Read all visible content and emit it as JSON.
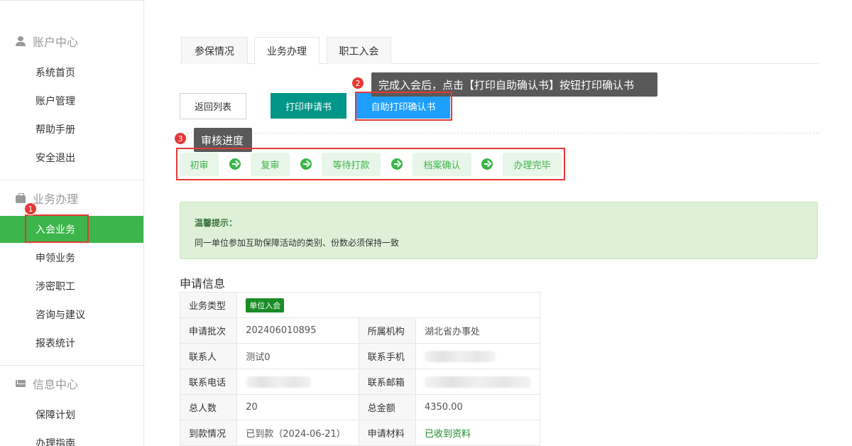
{
  "sidebar": {
    "account_center": {
      "title": "账户中心",
      "items": [
        "系统首页",
        "账户管理",
        "帮助手册",
        "安全退出"
      ]
    },
    "business": {
      "title": "业务办理",
      "items": [
        "入会业务",
        "申领业务",
        "涉密职工",
        "咨询与建议",
        "报表统计"
      ]
    },
    "info_center": {
      "title": "信息中心",
      "items": [
        "保障计划",
        "办理指南"
      ]
    }
  },
  "tabs": [
    "参保情况",
    "业务办理",
    "职工入会"
  ],
  "active_tab": "业务办理",
  "active_nav": "入会业务",
  "buttons": {
    "back": "返回列表",
    "print_application": "打印申请书",
    "self_print": "自助打印确认书"
  },
  "markers": [
    "1",
    "2",
    "3"
  ],
  "tooltips": {
    "print_hint": "完成入会后，点击【打印自助确认书】按钮打印确认书",
    "progress": "审核进度"
  },
  "progress_steps": [
    "初审",
    "复审",
    "等待打款",
    "档案确认",
    "办理完毕"
  ],
  "tip": {
    "title": "温馨提示：",
    "text": "同一单位参加互助保障活动的类别、份数必须保持一致"
  },
  "application_info": {
    "title": "申请信息",
    "business_type_label": "业务类型",
    "business_type": "单位入会",
    "rows": [
      [
        "申请批次",
        "202406010895",
        "所属机构",
        "湖北省办事处"
      ],
      [
        "联系人",
        "测试0",
        "联系手机",
        ""
      ],
      [
        "联系电话",
        "",
        "联系邮箱",
        ""
      ],
      [
        "总人数",
        "20",
        "总金额",
        "4350.00"
      ],
      [
        "到款情况",
        "已到款（2024-06-21）",
        "申请材料",
        "已收到资料"
      ]
    ]
  },
  "colors": {
    "brand_green": "#3cb54a",
    "teal": "#009688",
    "blue": "#1e9fff",
    "marker_red": "#e53935"
  }
}
